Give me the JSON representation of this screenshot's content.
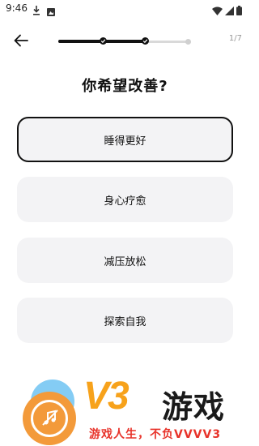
{
  "status_bar": {
    "time": "9:46",
    "icons": [
      "download-icon",
      "image-icon",
      "wifi-icon",
      "signal-icon",
      "battery-icon"
    ]
  },
  "header": {
    "step_counter": "1/7",
    "progress": {
      "completed_steps": 2,
      "total_steps": 3
    }
  },
  "question": "你希望改善?",
  "options": [
    {
      "label": "睡得更好",
      "selected": true
    },
    {
      "label": "身心疗愈",
      "selected": false
    },
    {
      "label": "减压放松",
      "selected": false
    },
    {
      "label": "探索自我",
      "selected": false
    }
  ],
  "watermark": {
    "brand": "V3",
    "brand_suffix": "游戏",
    "slogan": "游戏人生，不负VVVV3",
    "colors": {
      "orange": "#f7a21b",
      "blue": "#6ec3f2",
      "red": "#e8332a"
    }
  }
}
